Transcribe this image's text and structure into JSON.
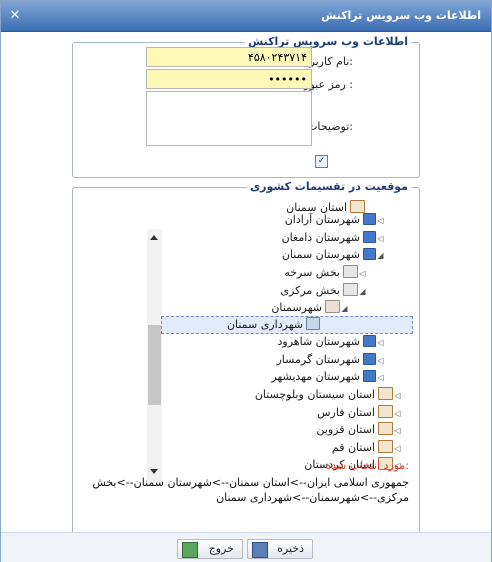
{
  "window": {
    "title": "اطلاعات وب سرویس تراکنش",
    "close_label": "✕"
  },
  "web_service": {
    "legend": "اطلاعات وب سرویس تراکنش",
    "username_label": "نام کاربری:",
    "username_value": "۴۵۸۰۲۴۳۷۱۴",
    "password_label": "رمز عبور :",
    "password_value": "••••••",
    "description_label": "توضیحات:",
    "description_value": "",
    "checkbox_checked": true
  },
  "location": {
    "legend": "موقعیت در تقسیمات کشوری",
    "tree": [
      {
        "label": "استان سمنان",
        "icon": "province-icon",
        "expander": ""
      },
      {
        "label": "شهرستان آرادان",
        "icon": "district-icon",
        "expander": "◁"
      },
      {
        "label": "شهرستان دامغان",
        "icon": "district-icon",
        "expander": "◁"
      },
      {
        "label": "شهرستان سمنان",
        "icon": "district-icon",
        "expander": "◢"
      },
      {
        "label": "بخش سرخه",
        "icon": "section-icon",
        "expander": "◁"
      },
      {
        "label": "بخش مرکزی",
        "icon": "section-icon",
        "expander": "◢"
      },
      {
        "label": "شهرسمنان",
        "icon": "city-icon",
        "expander": "◢"
      },
      {
        "label": "شهرداری سمنان",
        "icon": "municipality-icon",
        "expander": ""
      },
      {
        "label": "شهرستان شاهرود",
        "icon": "district-icon",
        "expander": "◁"
      },
      {
        "label": "شهرستان گرمسار",
        "icon": "district-icon",
        "expander": "◁"
      },
      {
        "label": "شهرستان مهدیشهر",
        "icon": "district-icon",
        "expander": "◁"
      },
      {
        "label": "استان سیستان وبلوچستان",
        "icon": "province-icon",
        "expander": "◁"
      },
      {
        "label": "استان فارس",
        "icon": "province-icon",
        "expander": "◁"
      },
      {
        "label": "استان قزوین",
        "icon": "province-icon",
        "expander": "◁"
      },
      {
        "label": "استان قم",
        "icon": "province-icon",
        "expander": "◁"
      },
      {
        "label": "استان کردستان",
        "icon": "province-icon",
        "expander": "◁"
      }
    ],
    "selected_title": "مورد انتخاب شده:",
    "selected_path": "جمهوری اسلامی ایران-->استان سمنان-->شهرستان سمنان-->بخش مرکزی-->شهرسمنان-->شهرداری سمنان"
  },
  "footer": {
    "save_label": "ذخیره",
    "exit_label": "خروج"
  },
  "colors": {
    "title_bar": "#4a7bc0",
    "input_highlight": "#fff9b8",
    "selected_caption": "#e03a2a"
  }
}
